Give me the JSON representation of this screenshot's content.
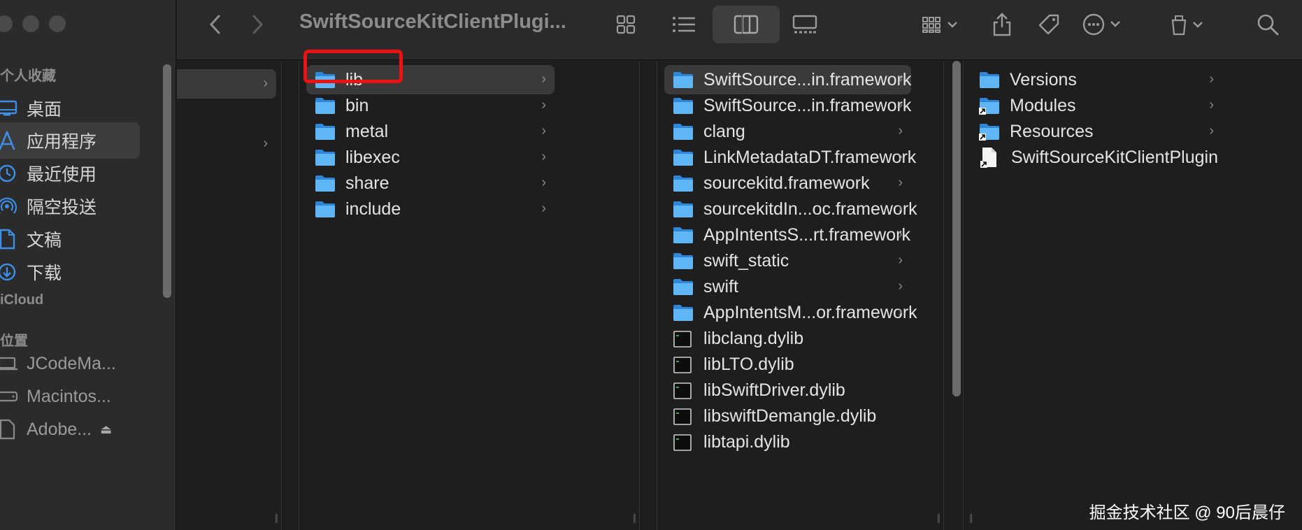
{
  "window": {
    "title": "SwiftSourceKitClientPlugi...",
    "traffic_lights": [
      "close",
      "minimize",
      "zoom"
    ]
  },
  "toolbar": {
    "buttons": [
      {
        "name": "back-button",
        "icon": "chevron-left-icon"
      },
      {
        "name": "forward-button",
        "icon": "chevron-right-icon"
      },
      {
        "name": "icon-view-button",
        "icon": "grid-icon"
      },
      {
        "name": "list-view-button",
        "icon": "list-icon"
      },
      {
        "name": "column-view-button",
        "icon": "columns-icon",
        "active": true
      },
      {
        "name": "gallery-view-button",
        "icon": "gallery-icon"
      },
      {
        "name": "group-button",
        "icon": "group-grid-icon"
      },
      {
        "name": "share-button",
        "icon": "share-icon"
      },
      {
        "name": "tag-button",
        "icon": "tag-icon"
      },
      {
        "name": "action-button",
        "icon": "ellipsis-circle-icon"
      },
      {
        "name": "app-button",
        "icon": "app-icon"
      },
      {
        "name": "search-button",
        "icon": "search-icon"
      }
    ]
  },
  "sidebar": {
    "favorites_title": "个人收藏",
    "favorites": [
      {
        "label": "桌面",
        "icon": "desktop-icon"
      },
      {
        "label": "应用程序",
        "icon": "applications-icon",
        "selected": true
      },
      {
        "label": "最近使用",
        "icon": "recents-icon"
      },
      {
        "label": "隔空投送",
        "icon": "airdrop-icon"
      },
      {
        "label": "文稿",
        "icon": "document-icon"
      },
      {
        "label": "下载",
        "icon": "download-icon"
      }
    ],
    "icloud_title": "iCloud",
    "locations_title": "位置",
    "locations": [
      {
        "label": "JCodeMa...",
        "icon": "laptop-icon"
      },
      {
        "label": "Macintos...",
        "icon": "disk-icon"
      },
      {
        "label": "Adobe...",
        "icon": "file-icon",
        "eject": true
      }
    ]
  },
  "columns": {
    "col2": [
      {
        "label": "lib",
        "type": "folder",
        "selected": true
      },
      {
        "label": "bin",
        "type": "folder"
      },
      {
        "label": "metal",
        "type": "folder"
      },
      {
        "label": "libexec",
        "type": "folder"
      },
      {
        "label": "share",
        "type": "folder"
      },
      {
        "label": "include",
        "type": "folder"
      }
    ],
    "col3": [
      {
        "label": "SwiftSource...in.framework",
        "type": "folder",
        "selected": true
      },
      {
        "label": "SwiftSource...in.framework",
        "type": "folder"
      },
      {
        "label": "clang",
        "type": "folder"
      },
      {
        "label": "LinkMetadataDT.framework",
        "type": "folder"
      },
      {
        "label": "sourcekitd.framework",
        "type": "folder"
      },
      {
        "label": "sourcekitdIn...oc.framework",
        "type": "folder"
      },
      {
        "label": "AppIntentsS...rt.framework",
        "type": "folder"
      },
      {
        "label": "swift_static",
        "type": "folder"
      },
      {
        "label": "swift",
        "type": "folder"
      },
      {
        "label": "AppIntentsM...or.framework",
        "type": "folder"
      },
      {
        "label": "libclang.dylib",
        "type": "exec"
      },
      {
        "label": "libLTO.dylib",
        "type": "exec"
      },
      {
        "label": "libSwiftDriver.dylib",
        "type": "exec"
      },
      {
        "label": "libswiftDemangle.dylib",
        "type": "exec"
      },
      {
        "label": "libtapi.dylib",
        "type": "exec"
      }
    ],
    "col4": [
      {
        "label": "Versions",
        "type": "folder"
      },
      {
        "label": "Modules",
        "type": "folder-alias"
      },
      {
        "label": "Resources",
        "type": "folder-alias"
      },
      {
        "label": "SwiftSourceKitClientPlugin",
        "type": "doc-alias"
      }
    ]
  },
  "watermark": "掘金技术社区 @ 90后晨仔",
  "colors": {
    "accent": "#3d8ee6",
    "highlight": "#ee1111",
    "folder": "#5eb6f5"
  }
}
